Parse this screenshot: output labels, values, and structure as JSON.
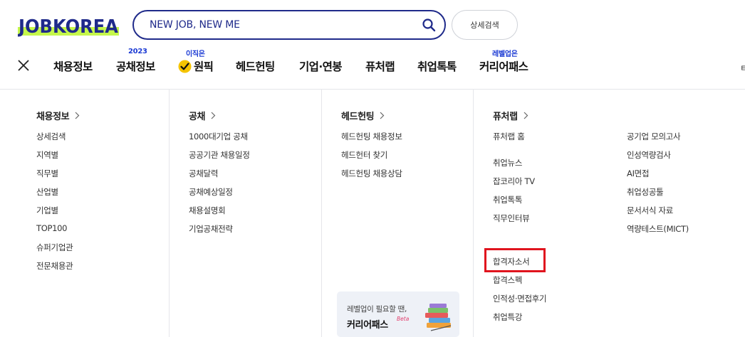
{
  "brand": {
    "logo_text": "JOBKOREA",
    "logo_color": "#1f2a8a",
    "logo_accent": "#c5f74b"
  },
  "search": {
    "value": "NEW JOB, NEW ME",
    "icon": "search-icon"
  },
  "header": {
    "advanced_search_label": "상세검색"
  },
  "nav": {
    "items": [
      {
        "label": "채용정보"
      },
      {
        "label": "공채정보",
        "badge": "2023"
      },
      {
        "label": "원픽",
        "badge": "이직은"
      },
      {
        "label": "헤드헌팅"
      },
      {
        "label": "기업·연봉"
      },
      {
        "label": "퓨처랩"
      },
      {
        "label": "취업톡톡"
      },
      {
        "label": "커리어패스",
        "badge": "레벨업은"
      }
    ],
    "edge_glyph": "ㅌ"
  },
  "menu": {
    "columns": [
      {
        "heading": "채용정보",
        "links": [
          "상세검색",
          "지역별",
          "직무별",
          "산업별",
          "기업별",
          "TOP100",
          "슈퍼기업관",
          "전문채용관"
        ]
      },
      {
        "heading": "공채",
        "links": [
          "1000대기업 공채",
          "공공기관 채용일정",
          "공채달력",
          "공채예상일정",
          "채용설명회",
          "기업공채전략"
        ]
      },
      {
        "heading": "헤드헌팅",
        "links": [
          "헤드헌팅 채용정보",
          "헤드헌터 찾기",
          "헤드헌팅 채용상담"
        ]
      },
      {
        "heading": "퓨처랩",
        "links_a": [
          "퓨처랩 홈",
          "취업뉴스",
          "잡코리아 TV",
          "취업톡톡",
          "직무인터뷰",
          "합격자소서",
          "합격스펙",
          "인적성·면접후기",
          "취업특강"
        ],
        "links_b": [
          "공기업 모의고사",
          "인성역량검사",
          "AI면접",
          "취업성공툴",
          "문서서식 자료",
          "역량테스트(MICT)"
        ]
      }
    ]
  },
  "promo": {
    "line1": "레벨업이 필요할 땐,",
    "line2": "커리어패스",
    "beta": "Beta"
  },
  "colors": {
    "highlight": "#e0141e",
    "badge": "#1c3bd4",
    "check": "#f5c400"
  }
}
